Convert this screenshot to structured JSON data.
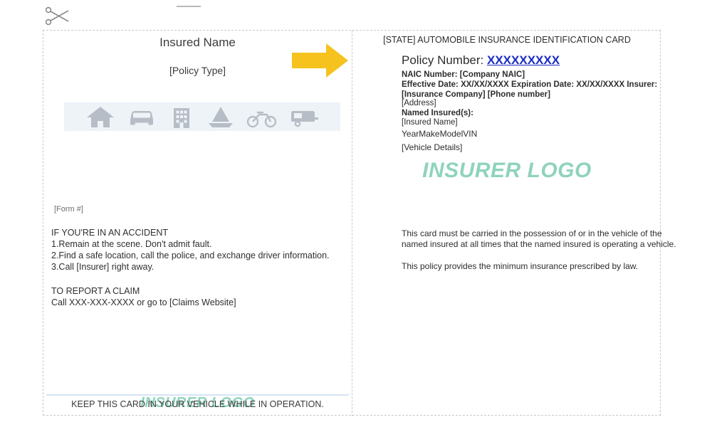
{
  "document": {
    "cut_line_icon": "scissors-icon",
    "left_panel": {
      "insured_name": "Insured Name",
      "policy_type": "[Policy Type]",
      "icons": [
        {
          "name": "home-icon"
        },
        {
          "name": "car-icon"
        },
        {
          "name": "building-icon"
        },
        {
          "name": "boat-icon"
        },
        {
          "name": "motorcycle-icon"
        },
        {
          "name": "trailer-icon"
        }
      ],
      "form_number": "[Form #]",
      "accident_heading": "IF YOU'RE IN AN ACCIDENT",
      "accident_steps": [
        "1.Remain at the scene. Don't admit fault.",
        "2.Find a safe location, call the police, and exchange driver information.",
        "3.Call [Insurer] right away."
      ],
      "claim_heading": "TO REPORT A CLAIM",
      "claim_text": "Call XXX-XXX-XXXX or go to [Claims Website]",
      "logo_text": "INSURER LOGO",
      "footer_text": "KEEP THIS CARD IN YOUR VEHICLE WHILE IN OPERATION."
    },
    "right_panel": {
      "title": "[STATE] AUTOMOBILE INSURANCE IDENTIFICATION CARD",
      "policy_number_label": "Policy Number:",
      "policy_number_value": "XXXXXXXXX",
      "naic_line": "NAIC Number: [Company NAIC]",
      "effective_line": "Effective Date: XX/XX/XXXX Expiration Date: XX/XX/XXXX Insurer: [Insurance Company] [Phone number]",
      "address_line": "[Address]",
      "named_insured_label": "Named Insured(s):",
      "insured_name_line": "[Insured Name]",
      "vehicle_header": "YearMakeModelVIN",
      "vehicle_details": "[Vehicle Details]",
      "logo_text": "INSURER LOGO",
      "notice_1": "This card must be carried in the possession of or in the vehicle of the named insured at all times that the named insured is operating a vehicle.",
      "notice_2": "This policy provides the minimum insurance prescribed by law."
    },
    "annotation": {
      "arrow_icon": "right-arrow-annotation",
      "arrow_color": "#f5c21e"
    },
    "colors": {
      "logo_green": "#8fd3bd",
      "policy_blue": "#1a2cc0",
      "icon_band": "#eef3f8",
      "icon_gray": "#b7bdc6",
      "border_dash": "#c9c9c9"
    }
  }
}
